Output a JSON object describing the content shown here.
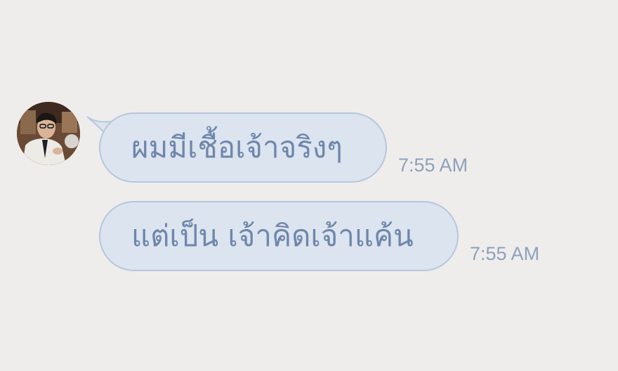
{
  "contact": {
    "avatar_icon": "profile-photo-man-glasses-tie"
  },
  "messages": [
    {
      "text": "ผมมีเชื้อเจ้าจริงๆ",
      "time": "7:55 AM"
    },
    {
      "text": "แต่เป็น เจ้าคิดเจ้าแค้น",
      "time": "7:55 AM"
    }
  ],
  "colors": {
    "background": "#efedeb",
    "bubble_fill": "#dbe4ef",
    "bubble_border": "#b7c7dc",
    "bubble_text": "#6f86ab",
    "timestamp": "#8ea0bd"
  }
}
